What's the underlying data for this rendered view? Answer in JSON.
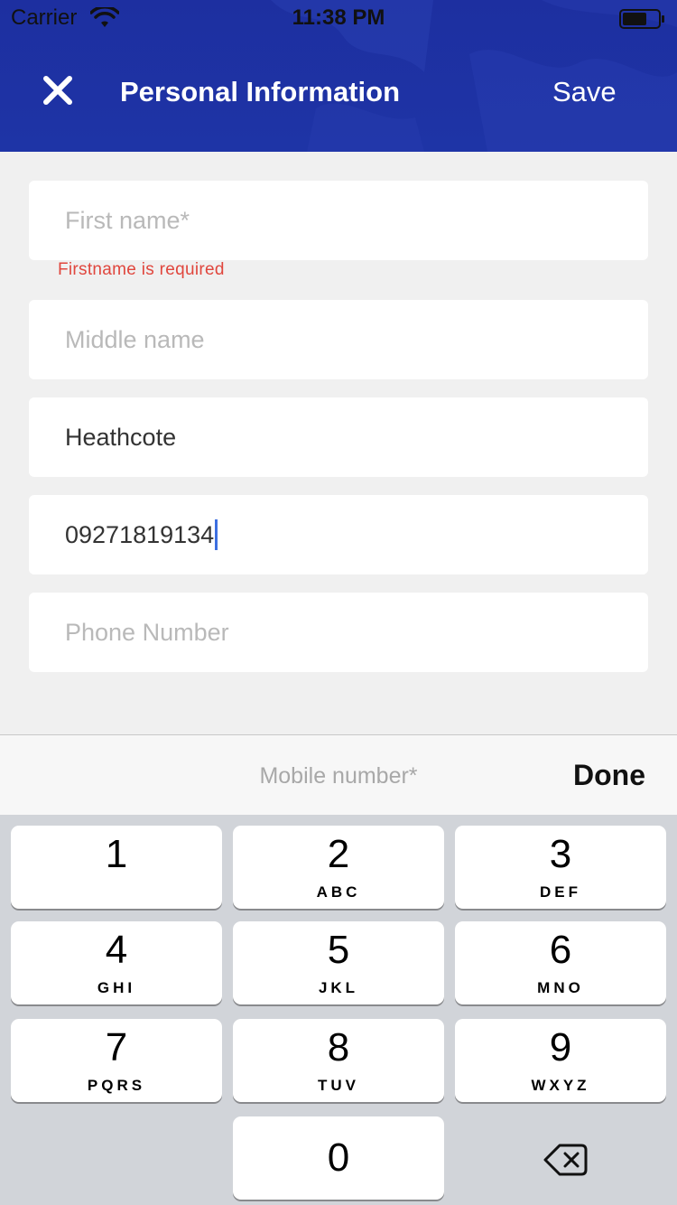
{
  "status_bar": {
    "carrier": "Carrier",
    "time": "11:38 PM"
  },
  "header": {
    "title": "Personal Information",
    "save_label": "Save",
    "close_icon": "close-icon",
    "background_color": "#1e33a3"
  },
  "form": {
    "first_name": {
      "placeholder": "First name*",
      "value": "",
      "error": "Firstname is required"
    },
    "middle_name": {
      "placeholder": "Middle name",
      "value": ""
    },
    "last_name": {
      "placeholder": "",
      "value": "Heathcote"
    },
    "mobile_number": {
      "placeholder": "Mobile number*",
      "value": "09271819134"
    },
    "phone_number": {
      "placeholder": "Phone Number",
      "value": ""
    }
  },
  "accessory": {
    "label": "Mobile number*",
    "done_label": "Done"
  },
  "keyboard": {
    "keys": [
      {
        "digit": "1",
        "letters": ""
      },
      {
        "digit": "2",
        "letters": "ABC"
      },
      {
        "digit": "3",
        "letters": "DEF"
      },
      {
        "digit": "4",
        "letters": "GHI"
      },
      {
        "digit": "5",
        "letters": "JKL"
      },
      {
        "digit": "6",
        "letters": "MNO"
      },
      {
        "digit": "7",
        "letters": "PQRS"
      },
      {
        "digit": "8",
        "letters": "TUV"
      },
      {
        "digit": "9",
        "letters": "WXYZ"
      },
      {
        "digit": "0",
        "letters": ""
      }
    ],
    "backspace_icon": "backspace-icon"
  },
  "colors": {
    "error": "#e0463d",
    "caret": "#3d6fe0",
    "placeholder": "#b9b9b9"
  }
}
